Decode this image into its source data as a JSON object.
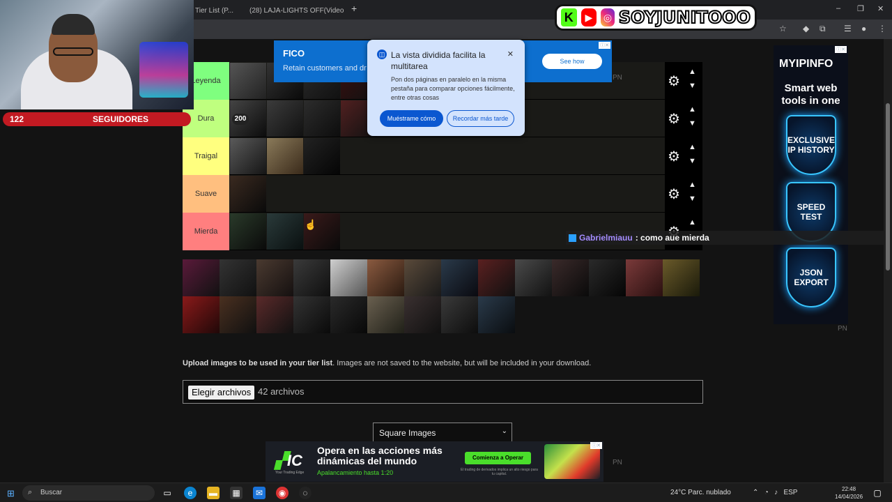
{
  "browser": {
    "tabs": [
      {
        "title": "Tier List (P..."
      },
      {
        "title": "(28) LAJA-LIGHTS OFF(Video O..."
      }
    ],
    "new_tab": "+",
    "window_controls": [
      "–",
      "❐",
      "✕"
    ]
  },
  "overlay": {
    "followers_count": "122",
    "followers_label": "SEGUIDORES",
    "social_handle": "SOYJUNITOOO",
    "social_icons": [
      "kick-icon",
      "youtube-icon",
      "instagram-icon"
    ],
    "chat": {
      "user": "Gabrielmiauu",
      "message": ": como aue mierda"
    },
    "badge_200": "200"
  },
  "tiers": [
    {
      "label": "Leyenda",
      "color": "#7fff7f",
      "images": 4
    },
    {
      "label": "Dura",
      "color": "#bfff7f",
      "images": 4
    },
    {
      "label": "Traigal",
      "color": "#ffff7f",
      "images": 3
    },
    {
      "label": "Suave",
      "color": "#ffbf7f",
      "images": 1
    },
    {
      "label": "Mierda",
      "color": "#ff7f7f",
      "images": 3
    }
  ],
  "upload": {
    "bold": "Upload images to be used in your tier list",
    "rest": ". Images are not saved to the website, but will be included in your download.",
    "button": "Elegir archivos",
    "count": "42 archivos"
  },
  "select": {
    "value": "Square Images"
  },
  "ads": {
    "fico": {
      "logo": "FICO",
      "sub": "Retain customers and dr",
      "cta": "See how"
    },
    "ipinfo": {
      "brand": "MYIPINFO",
      "tag": "Smart web tools in one",
      "shields": [
        "EXCLUSIVE IP HISTORY",
        "SPEED TEST",
        "JSON EXPORT"
      ]
    },
    "ic": {
      "logo": "IC",
      "logo_sub": "Your Trading Edge",
      "headline": "Opera en las acciones más dinámicas del mundo",
      "leverage": "Apalancamiento hasta 1:20",
      "cta": "Comienza a Operar",
      "disclaimer": "El trading de derivados implica un alto riesgo para tu capital."
    },
    "pn": "PN"
  },
  "popup": {
    "title": "La vista dividida facilita la multitarea",
    "body": "Pon dos páginas en paralelo en la misma pestaña para comparar opciones fácilmente, entre otras cosas",
    "primary": "Muéstrame cómo",
    "secondary": "Recordar más tarde"
  },
  "taskbar": {
    "search": "Buscar",
    "weather": "24°C  Parc. nublado",
    "lang": "ESP",
    "time": "22:48",
    "date": "14/04/2026"
  },
  "colors": {
    "accent_blue": "#0b57d0",
    "follower_red": "#c21a22",
    "kick_green": "#53fc18"
  }
}
